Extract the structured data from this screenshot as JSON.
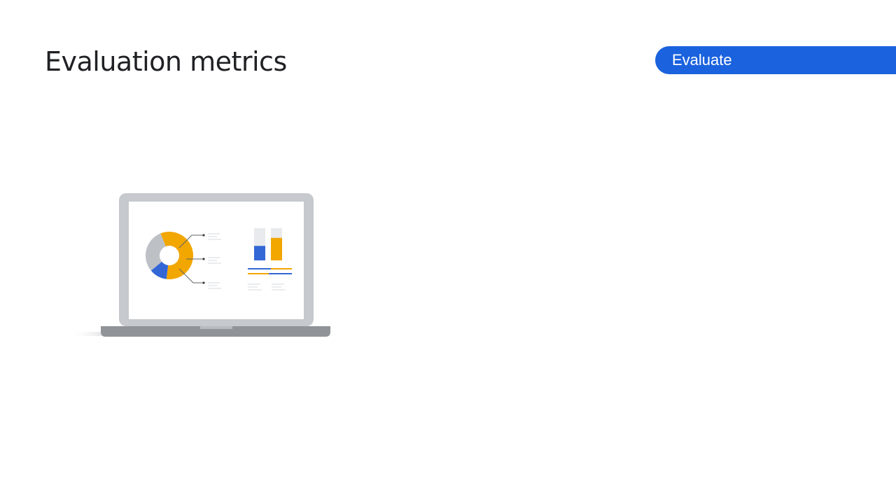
{
  "slide": {
    "title": "Evaluation metrics",
    "stage_label": "Evaluate"
  },
  "colors": {
    "pill_background": "#1a62de",
    "donut_orange": "#f2a600",
    "donut_blue": "#3367d6",
    "donut_gray": "#bdc1c6",
    "laptop_frame": "#c6c9cd",
    "laptop_base": "#909498"
  },
  "illustration": {
    "name": "laptop-dashboard",
    "donut_fractions": {
      "orange": 0.58,
      "blue": 0.12,
      "gray": 0.3
    },
    "bar_fill_levels": [
      0.45,
      0.7
    ]
  }
}
